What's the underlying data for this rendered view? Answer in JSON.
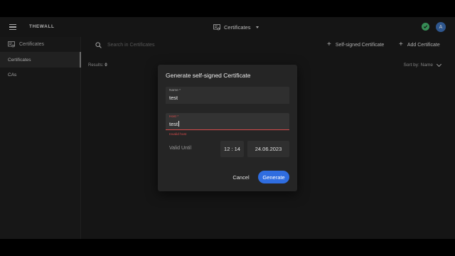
{
  "topbar": {
    "brand": "THEWALL",
    "context_label": "Certificates",
    "avatar_initial": "A"
  },
  "sidebar": {
    "header": "Certificates",
    "items": [
      {
        "label": "Certificates",
        "active": true
      },
      {
        "label": "CAs",
        "active": false
      }
    ]
  },
  "main": {
    "search_placeholder": "Search in Certificates",
    "self_signed_label": "Self-signed Certificate",
    "add_label": "Add Certificate",
    "results_label": "Results:",
    "results_count": "0",
    "sort_label": "Sort by: Name"
  },
  "dialog": {
    "title": "Generate self-signed Certificate",
    "name_label": "Name *",
    "name_value": "test",
    "host_label": "Host *",
    "host_value": "test",
    "host_error": "Invalid host",
    "valid_until_label": "Valid Until",
    "time_value": "12 : 14",
    "date_value": "24.06.2023",
    "cancel_label": "Cancel",
    "generate_label": "Generate"
  },
  "colors": {
    "accent": "#2f6de0",
    "error": "#d64b4b",
    "status_ok": "#46b46e",
    "avatar": "#3b6fb6"
  }
}
